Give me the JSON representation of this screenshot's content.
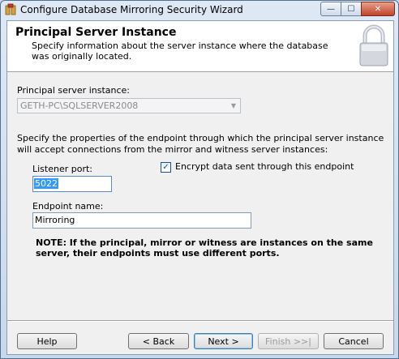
{
  "window": {
    "title": "Configure Database Mirroring Security Wizard"
  },
  "header": {
    "title": "Principal Server Instance",
    "description": "Specify information about the server instance where the database was originally located."
  },
  "principal": {
    "label": "Principal server instance:",
    "value": "GETH-PC\\SQLSERVER2008"
  },
  "endpoint": {
    "instructions": "Specify the properties of the endpoint through which the principal server instance will accept connections from the mirror and witness server instances:",
    "listener_port_label": "Listener port:",
    "listener_port_value": "5022",
    "encrypt_label": "Encrypt data sent through this endpoint",
    "encrypt_checked": true,
    "name_label": "Endpoint name:",
    "name_value": "Mirroring",
    "note": "NOTE: If the principal, mirror or witness are instances on the same server, their endpoints must use different ports."
  },
  "buttons": {
    "help": "Help",
    "back": "< Back",
    "next": "Next >",
    "finish": "Finish >>|",
    "cancel": "Cancel"
  },
  "icons": {
    "checkmark": "✓",
    "dropdown": "▼",
    "minimize": "—",
    "maximize": "☐",
    "close": "✕"
  }
}
